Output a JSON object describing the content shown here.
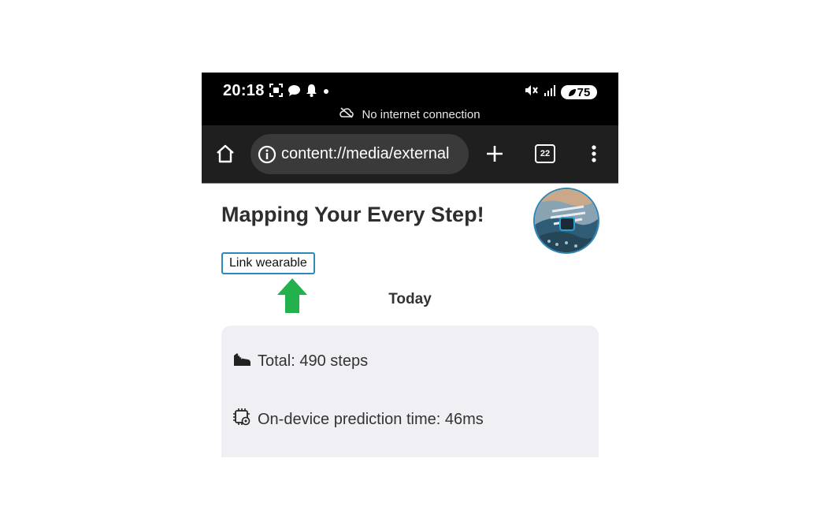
{
  "status_bar": {
    "time": "20:18",
    "battery": "75",
    "network_message": "No internet connection"
  },
  "browser": {
    "url": "content://media/external",
    "tab_count": "22"
  },
  "page": {
    "title": "Mapping Your Every Step!",
    "link_button": "Link wearable",
    "today_label": "Today",
    "stats": {
      "total_steps": "Total: 490 steps",
      "prediction_time": "On-device prediction time: 46ms"
    }
  },
  "colors": {
    "accent_border": "#2b8ab8",
    "arrow_green": "#22b14c",
    "card_bg": "#f0f0f4"
  },
  "icons": {
    "home": "home-icon",
    "info": "info-icon",
    "new_tab": "plus-icon",
    "tabs": "tab-switcher-icon",
    "menu": "more-vert-icon",
    "shoe": "shoe-icon",
    "chip": "chip-gear-icon",
    "arrow": "arrow-up-icon"
  }
}
